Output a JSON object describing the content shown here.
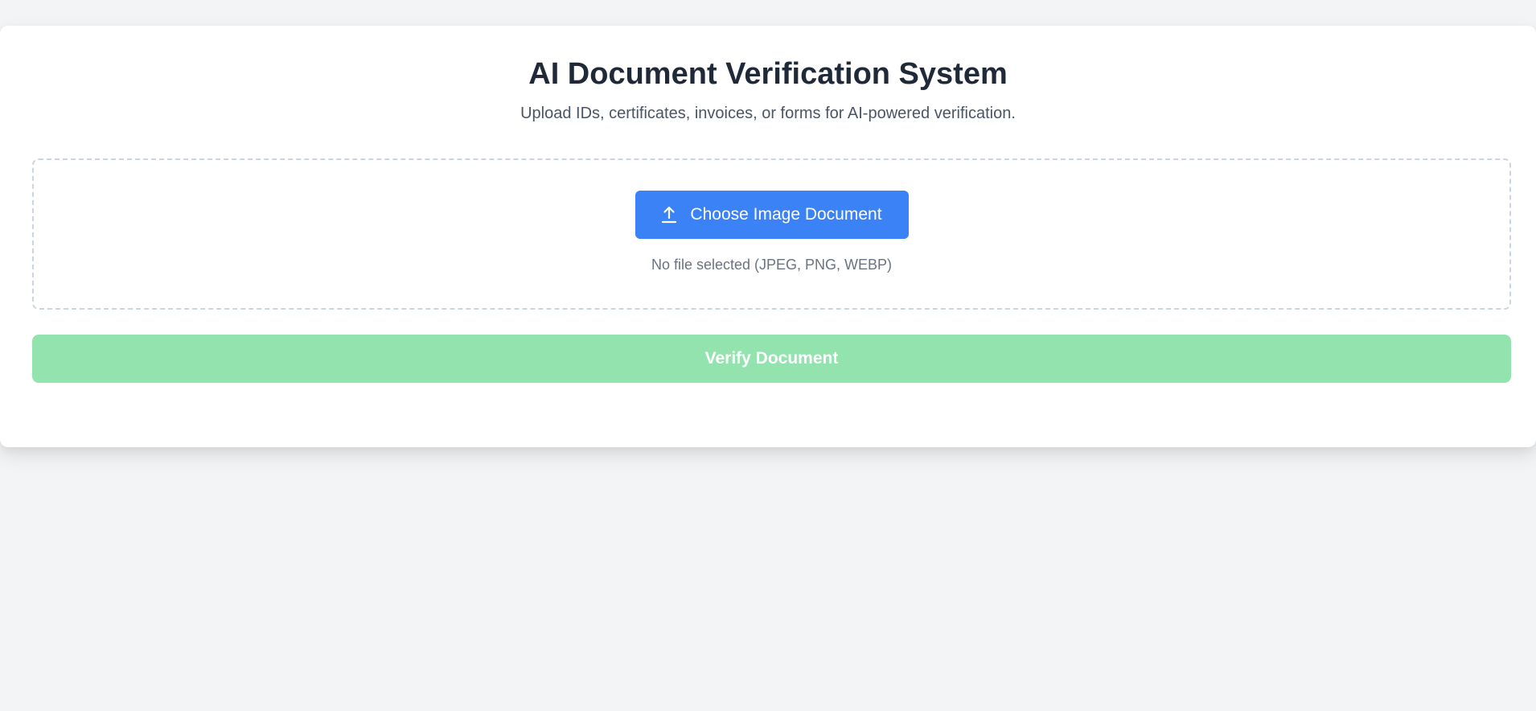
{
  "app": {
    "title": "AI Document Verification System",
    "subtitle": "Upload IDs, certificates, invoices, or forms for AI-powered verification."
  },
  "upload": {
    "choose_label": "Choose Image Document",
    "icon": "upload-icon",
    "status": "No file selected (JPEG, PNG, WEBP)"
  },
  "actions": {
    "verify_label": "Verify Document",
    "verify_disabled": true
  },
  "colors": {
    "background": "#f3f4f6",
    "card": "#ffffff",
    "primary": "#3b82f6",
    "verify_disabled": "#93e3ae",
    "title": "#1f2937",
    "subtitle": "#4b5563",
    "muted": "#6b7280"
  }
}
